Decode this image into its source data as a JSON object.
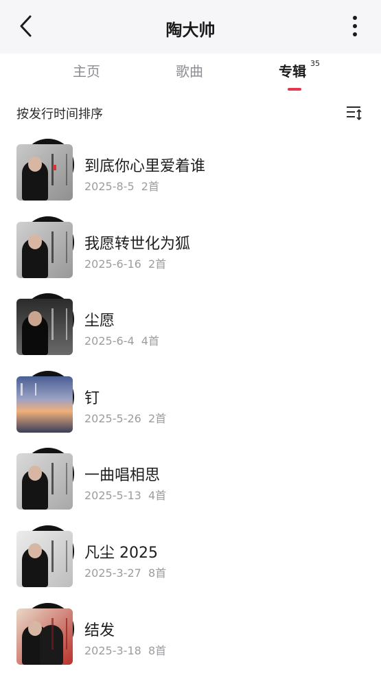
{
  "header": {
    "title": "陶大帅"
  },
  "tabs": [
    {
      "label": "主页",
      "active": false
    },
    {
      "label": "歌曲",
      "active": false
    },
    {
      "label": "专辑",
      "active": true,
      "count": "35"
    }
  ],
  "sort": {
    "label": "按发行时间排序"
  },
  "albums": [
    {
      "title": "到底你心里爱着谁",
      "date": "2025-8-5",
      "count": "2首",
      "cover": "portrait-grey"
    },
    {
      "title": "我愿转世化为狐",
      "date": "2025-6-16",
      "count": "2首",
      "cover": "portrait-grey"
    },
    {
      "title": "尘愿",
      "date": "2025-6-4",
      "count": "4首",
      "cover": "seated-dark"
    },
    {
      "title": "钉",
      "date": "2025-5-26",
      "count": "2首",
      "cover": "sunset"
    },
    {
      "title": "一曲唱相思",
      "date": "2025-5-13",
      "count": "4首",
      "cover": "seated-light"
    },
    {
      "title": "凡尘 2025",
      "date": "2025-3-27",
      "count": "8首",
      "cover": "portrait-light"
    },
    {
      "title": "结发",
      "date": "2025-3-18",
      "count": "8首",
      "cover": "couple-red"
    }
  ],
  "colors": {
    "accent": "#e8364d",
    "header_bg": "#f6f6f8",
    "meta_text": "#9c9ca1"
  }
}
